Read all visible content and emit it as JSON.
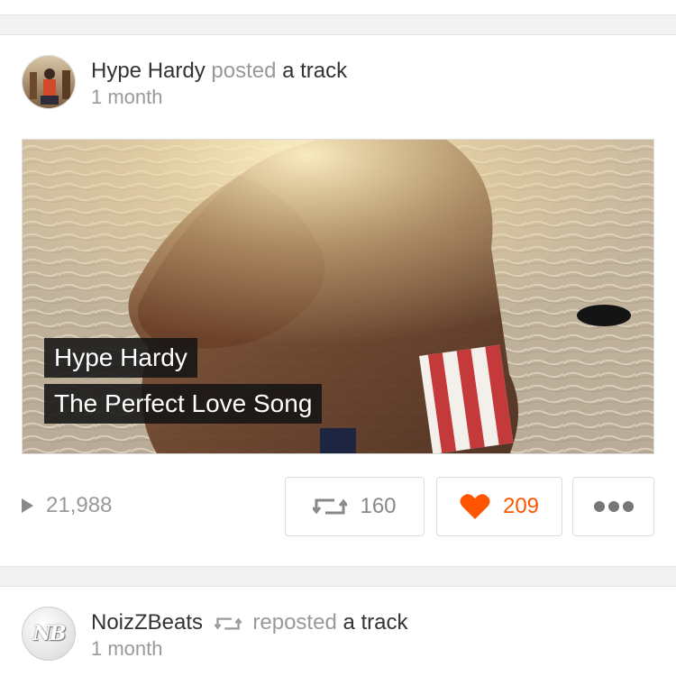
{
  "feed": {
    "post": {
      "user": "Hype Hardy",
      "verb": "posted",
      "object": "a track",
      "time": "1 month",
      "avatar_icon": "user-avatar-photo",
      "artwork": {
        "artist_label": "Hype Hardy",
        "title_label": "The Perfect Love Song"
      },
      "stats": {
        "plays": "21,988",
        "reposts": "160",
        "likes": "209",
        "like_color": "#ff5500"
      }
    },
    "next_post": {
      "user": "NoizZBeats",
      "verb": "reposted",
      "object": "a track",
      "time": "1 month",
      "avatar_text": "NB"
    }
  }
}
